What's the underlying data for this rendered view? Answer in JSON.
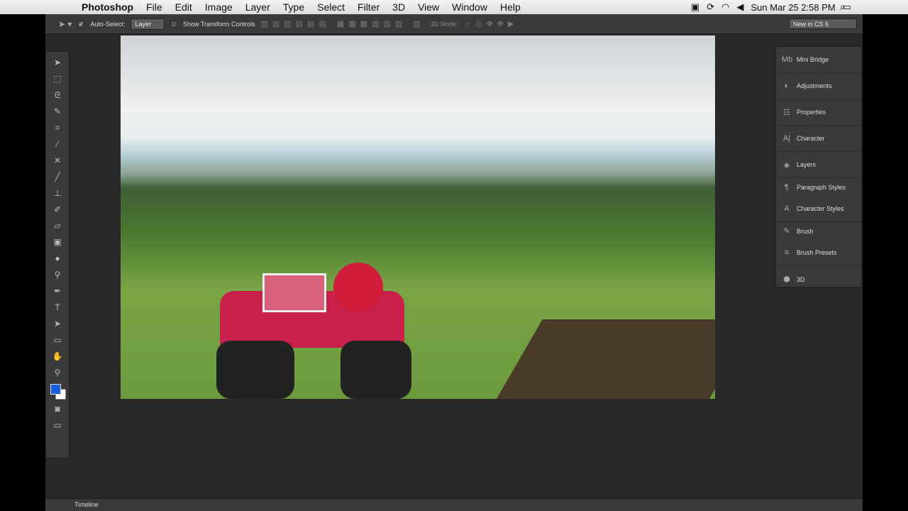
{
  "menubar": {
    "app": "Photoshop",
    "items": [
      "File",
      "Edit",
      "Image",
      "Layer",
      "Type",
      "Select",
      "Filter",
      "3D",
      "View",
      "Window",
      "Help"
    ],
    "clock": "Sun Mar 25  2:58 PM"
  },
  "options": {
    "auto_select": "Auto-Select:",
    "auto_select_value": "Layer",
    "show_transform": "Show Transform Controls",
    "mode_3d": "3D Mode:",
    "workspace": "New in CS 6"
  },
  "panels": [
    {
      "label": "Mini Bridge",
      "icon": "Mb"
    },
    {
      "label": "Adjustments",
      "icon": "◐"
    },
    {
      "label": "Properties",
      "icon": "☷"
    },
    {
      "label": "Character",
      "icon": "A|"
    },
    {
      "label": "Layers",
      "icon": "◈"
    },
    {
      "label": "Paragraph Styles",
      "icon": "¶"
    },
    {
      "label": "Character Styles",
      "icon": "A"
    },
    {
      "label": "Brush",
      "icon": "✎"
    },
    {
      "label": "Brush Presets",
      "icon": "≡"
    },
    {
      "label": "3D",
      "icon": "⬢"
    }
  ],
  "timeline": "Timeline",
  "colors": {
    "foreground": "#1a5fe0",
    "background": "#ffffff"
  }
}
